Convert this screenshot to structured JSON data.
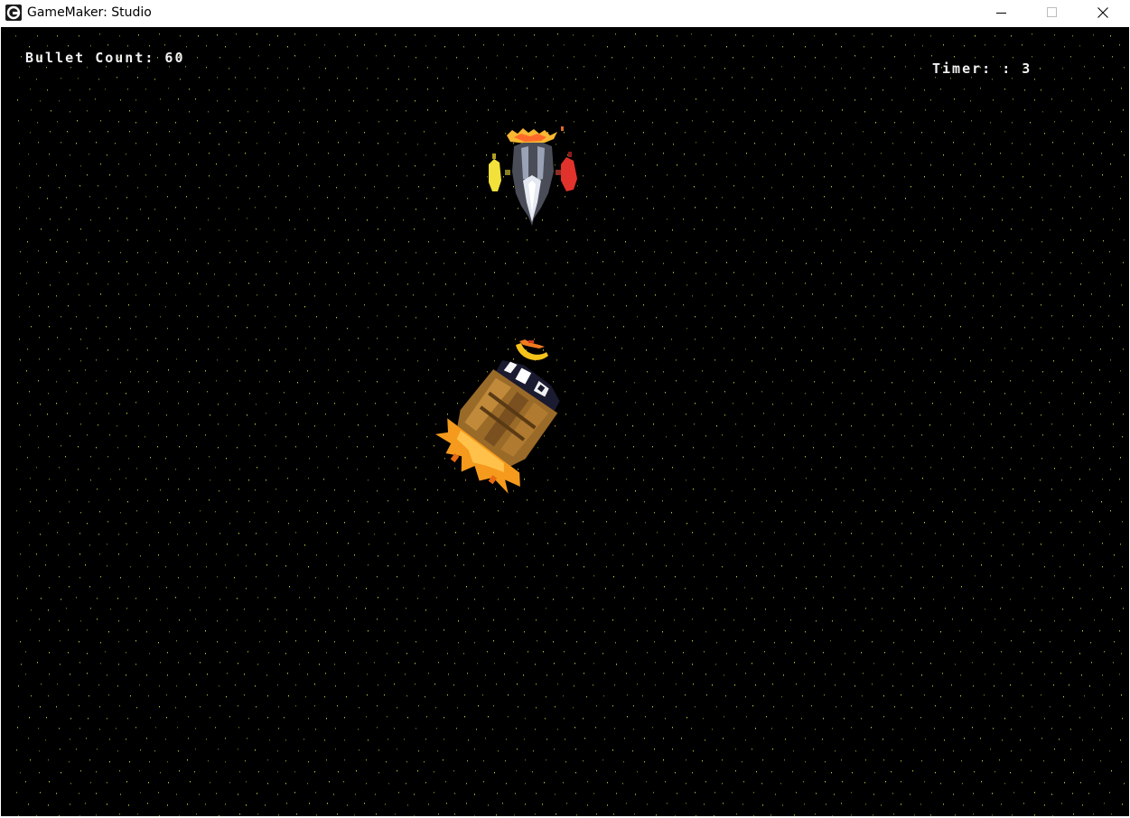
{
  "window": {
    "title": "GameMaker: Studio",
    "controls": {
      "minimize_icon": "minimize-icon",
      "maximize_icon": "maximize-icon",
      "close_icon": "close-icon"
    }
  },
  "hud": {
    "bullet_count_text": "Bullet Count: 60",
    "timer_text": "Timer: : 3"
  },
  "scene": {
    "background_color": "#000000",
    "star_color": "#c8c83c",
    "sprites": {
      "enemy_ship": "enemy-ship-sprite",
      "projectile": "projectile-sprite",
      "player_ship": "player-ship-sprite"
    }
  }
}
